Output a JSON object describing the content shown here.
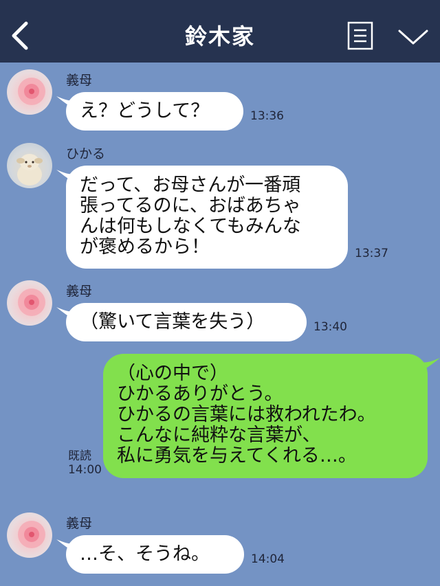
{
  "header": {
    "title": "鈴木家"
  },
  "messages": [
    {
      "sender": "義母",
      "avatar": "flower-avatar",
      "text": "え？どうして？",
      "time": "13:36"
    },
    {
      "sender": "ひかる",
      "avatar": "sheep-plush-avatar",
      "text": "だって、お母さんが一番頑\n張ってるのに、おばあちゃ\nんは何もしなくてもみんな\nが褒めるから！",
      "time": "13:37"
    },
    {
      "sender": "義母",
      "avatar": "flower-avatar",
      "text": "（驚いて言葉を失う）",
      "time": "13:40"
    },
    {
      "sender": "self",
      "text": "（心の中で）\nひかるありがとう。\nひかるの言葉には救われたわ。\nこんなに純粋な言葉が、\n私に勇気を与えてくれる…。",
      "read_label": "既読",
      "time": "14:00"
    },
    {
      "sender": "義母",
      "avatar": "flower-avatar",
      "text": "…そ、そうね。",
      "time": "14:04"
    }
  ],
  "colors": {
    "header_bg": "#263350",
    "chat_bg": "#7493c4",
    "incoming_bubble": "#ffffff",
    "outgoing_bubble": "#82e04d"
  },
  "icons": [
    "back-icon",
    "menu-icon",
    "chevron-down-icon"
  ]
}
